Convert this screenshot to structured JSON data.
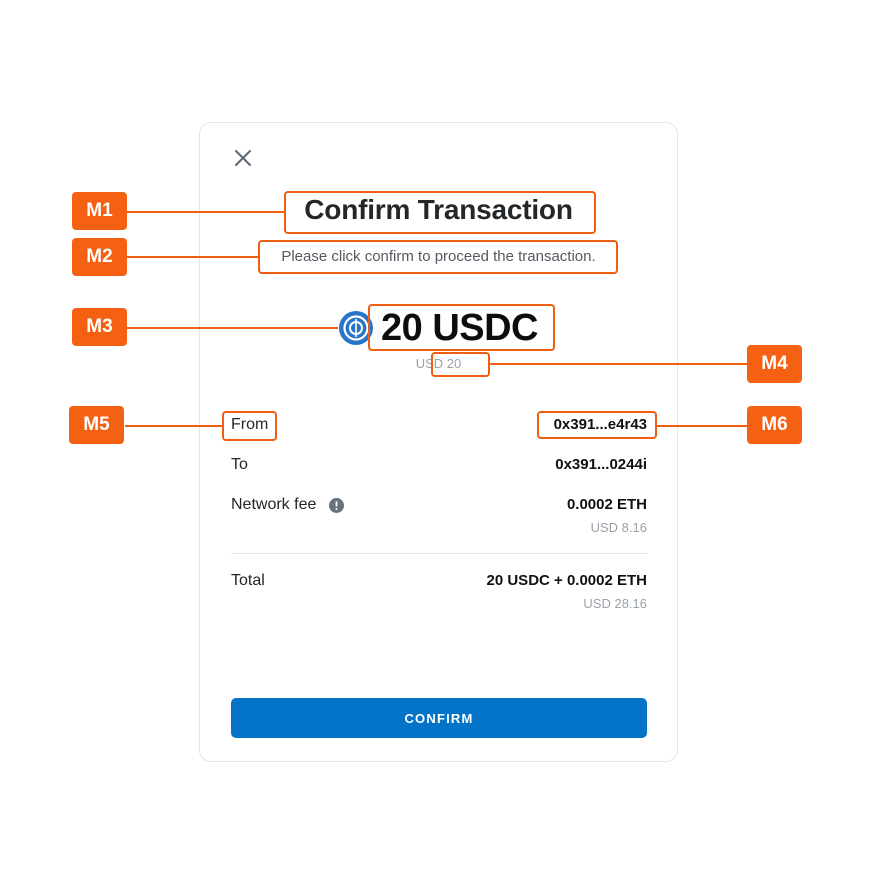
{
  "dialog": {
    "title": "Confirm Transaction",
    "subtitle": "Please click confirm to proceed the transaction."
  },
  "amount": {
    "value": "20 USDC",
    "usd": "USD 20",
    "token_icon": "usdc-icon"
  },
  "details": {
    "from": {
      "label": "From",
      "value": "0x391...e4r43"
    },
    "to": {
      "label": "To",
      "value": "0x391...0244i"
    },
    "network_fee": {
      "label": "Network fee",
      "value": "0.0002 ETH",
      "usd": "USD 8.16",
      "icon": "info-icon"
    },
    "total": {
      "label": "Total",
      "value": "20 USDC + 0.0002 ETH",
      "usd": "USD 28.16"
    }
  },
  "confirm_label": "CONFIRM",
  "markers": {
    "m1": "M1",
    "m2": "M2",
    "m3": "M3",
    "m4": "M4",
    "m5": "M5",
    "m6": "M6"
  },
  "colors": {
    "accent": "#0474c8",
    "marker": "#f56112",
    "title": "#24272a",
    "muted": "#9aa1a8"
  }
}
